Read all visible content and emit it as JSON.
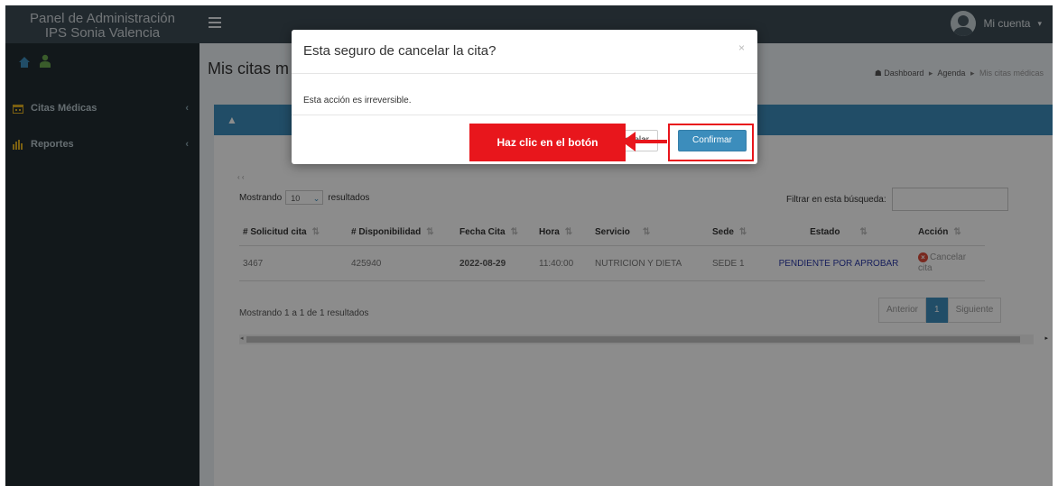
{
  "sidebar": {
    "brand_line1": "Panel de Administración",
    "brand_line2": "IPS Sonia Valencia",
    "items": [
      {
        "label": "Citas Médicas",
        "icon": "calendar-icon"
      },
      {
        "label": "Reportes",
        "icon": "bar-chart-icon"
      }
    ]
  },
  "header": {
    "account_label": "Mi cuenta",
    "account_caret": "▾"
  },
  "content": {
    "page_title": "Mis citas m",
    "breadcrumb": [
      "Dashboard",
      "Agenda",
      "Mis citas médicas"
    ],
    "tiny_nav": "‹ ‹",
    "show_label": "Mostrando",
    "show_value": "10",
    "show_suffix": "resultados",
    "filter_label": "Filtrar en esta búsqueda:",
    "table": {
      "headers": [
        "# Solicitud cita",
        "# Disponibilidad",
        "Fecha Cita",
        "Hora",
        "Servicio",
        "Sede",
        "Estado",
        "Acción"
      ],
      "rows": [
        {
          "solicitud": "3467",
          "disponibilidad": "425940",
          "fecha": "2022-08-29",
          "hora": "11:40:00",
          "servicio": "NUTRICION Y DIETA",
          "sede": "SEDE 1",
          "estado": "PENDIENTE POR APROBAR",
          "accion_line1": "Cancelar",
          "accion_line2": "cita"
        }
      ]
    },
    "info_text": "Mostrando 1 a 1 de 1 resultados",
    "pager": {
      "prev": "Anterior",
      "current": "1",
      "next": "Siguiente"
    }
  },
  "modal": {
    "title": "Esta seguro de cancelar la cita?",
    "close": "×",
    "body": "Esta acción es irreversible.",
    "cancel_label": "Cancelar",
    "confirm_label": "Confirmar"
  },
  "annotation": {
    "callout_text": "Haz clic en el botón",
    "color": "#e8161c"
  },
  "colors": {
    "primary": "#3c8dbc",
    "sidebar": "#222d32",
    "topbar": "#3c4b54",
    "status_pending": "#2b3aa8",
    "danger": "#dd4b39"
  }
}
